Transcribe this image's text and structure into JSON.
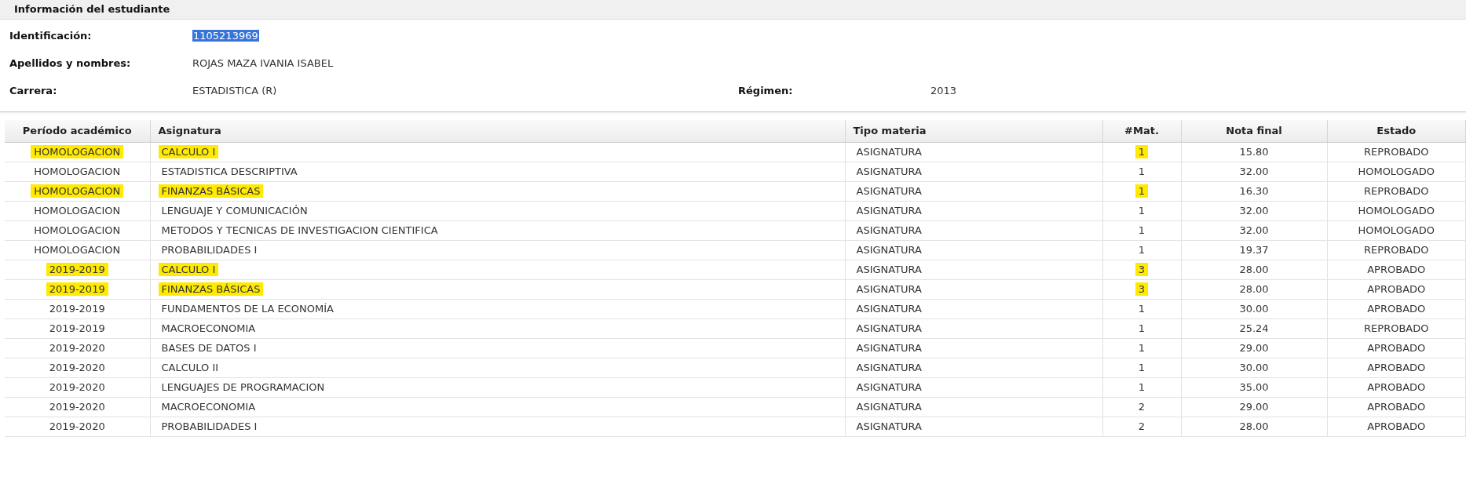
{
  "section": {
    "title": "Información del estudiante"
  },
  "fields": [
    {
      "label": "Identificación:",
      "value": "1105213969",
      "selected": true
    },
    {
      "label": "Apellidos y nombres:",
      "value": "ROJAS MAZA IVANIA ISABEL",
      "selected": false
    },
    {
      "label": "Carrera:",
      "value": "ESTADISTICA (R)",
      "selected": false,
      "extra_label": "Régimen:",
      "extra_value": "2013"
    }
  ],
  "table": {
    "columns": [
      "Período académico",
      "Asignatura",
      "Tipo materia",
      "#Mat.",
      "Nota final",
      "Estado"
    ],
    "rows": [
      {
        "period": "HOMOLOGACION",
        "subject": "CALCULO I",
        "type": "ASIGNATURA",
        "enrollments": "1",
        "grade": "15.80",
        "status": "REPROBADO",
        "highlighted": true
      },
      {
        "period": "HOMOLOGACION",
        "subject": "ESTADISTICA DESCRIPTIVA",
        "type": "ASIGNATURA",
        "enrollments": "1",
        "grade": "32.00",
        "status": "HOMOLOGADO",
        "highlighted": false
      },
      {
        "period": "HOMOLOGACION",
        "subject": "FINANZAS BÁSICAS",
        "type": "ASIGNATURA",
        "enrollments": "1",
        "grade": "16.30",
        "status": "REPROBADO",
        "highlighted": true
      },
      {
        "period": "HOMOLOGACION",
        "subject": "LENGUAJE Y COMUNICACIÓN",
        "type": "ASIGNATURA",
        "enrollments": "1",
        "grade": "32.00",
        "status": "HOMOLOGADO",
        "highlighted": false
      },
      {
        "period": "HOMOLOGACION",
        "subject": "METODOS Y TECNICAS DE INVESTIGACION CIENTIFICA",
        "type": "ASIGNATURA",
        "enrollments": "1",
        "grade": "32.00",
        "status": "HOMOLOGADO",
        "highlighted": false
      },
      {
        "period": "HOMOLOGACION",
        "subject": "PROBABILIDADES I",
        "type": "ASIGNATURA",
        "enrollments": "1",
        "grade": "19.37",
        "status": "REPROBADO",
        "highlighted": false
      },
      {
        "period": "2019-2019",
        "subject": "CALCULO I",
        "type": "ASIGNATURA",
        "enrollments": "3",
        "grade": "28.00",
        "status": "APROBADO",
        "highlighted": true
      },
      {
        "period": "2019-2019",
        "subject": "FINANZAS BÁSICAS",
        "type": "ASIGNATURA",
        "enrollments": "3",
        "grade": "28.00",
        "status": "APROBADO",
        "highlighted": true
      },
      {
        "period": "2019-2019",
        "subject": "FUNDAMENTOS DE LA ECONOMÍA",
        "type": "ASIGNATURA",
        "enrollments": "1",
        "grade": "30.00",
        "status": "APROBADO",
        "highlighted": false
      },
      {
        "period": "2019-2019",
        "subject": "MACROECONOMIA",
        "type": "ASIGNATURA",
        "enrollments": "1",
        "grade": "25.24",
        "status": "REPROBADO",
        "highlighted": false
      },
      {
        "period": "2019-2020",
        "subject": "BASES DE DATOS I",
        "type": "ASIGNATURA",
        "enrollments": "1",
        "grade": "29.00",
        "status": "APROBADO",
        "highlighted": false
      },
      {
        "period": "2019-2020",
        "subject": "CALCULO II",
        "type": "ASIGNATURA",
        "enrollments": "1",
        "grade": "30.00",
        "status": "APROBADO",
        "highlighted": false
      },
      {
        "period": "2019-2020",
        "subject": "LENGUAJES DE PROGRAMACION",
        "type": "ASIGNATURA",
        "enrollments": "1",
        "grade": "35.00",
        "status": "APROBADO",
        "highlighted": false
      },
      {
        "period": "2019-2020",
        "subject": "MACROECONOMIA",
        "type": "ASIGNATURA",
        "enrollments": "2",
        "grade": "29.00",
        "status": "APROBADO",
        "highlighted": false
      },
      {
        "period": "2019-2020",
        "subject": "PROBABILIDADES I",
        "type": "ASIGNATURA",
        "enrollments": "2",
        "grade": "28.00",
        "status": "APROBADO",
        "highlighted": false
      }
    ]
  }
}
